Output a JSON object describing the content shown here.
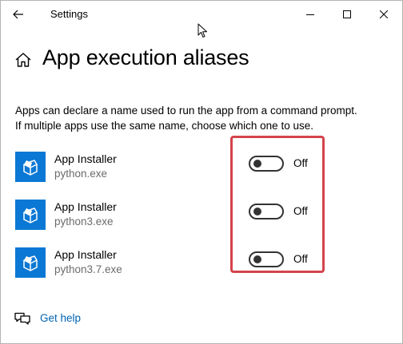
{
  "window": {
    "title": "Settings"
  },
  "colors": {
    "accent": "#0a78d4",
    "link": "#0063b1",
    "highlight_box": "#d4434b",
    "toggle_off": "#333333"
  },
  "header": {
    "title": "App execution aliases"
  },
  "description": {
    "line1": "Apps can declare a name used to run the app from a command prompt.",
    "line2": "If multiple apps use the same name, choose which one to use."
  },
  "aliases": [
    {
      "app": "App Installer",
      "exe": "python.exe",
      "state": "Off"
    },
    {
      "app": "App Installer",
      "exe": "python3.exe",
      "state": "Off"
    },
    {
      "app": "App Installer",
      "exe": "python3.7.exe",
      "state": "Off"
    }
  ],
  "help": {
    "label": "Get help"
  },
  "icons": {
    "back": "back-arrow-icon",
    "minimize": "minimize-icon",
    "maximize": "maximize-icon",
    "close": "close-icon",
    "home": "home-icon",
    "app": "package-icon",
    "help": "chat-help-icon",
    "cursor": "mouse-pointer-icon"
  }
}
